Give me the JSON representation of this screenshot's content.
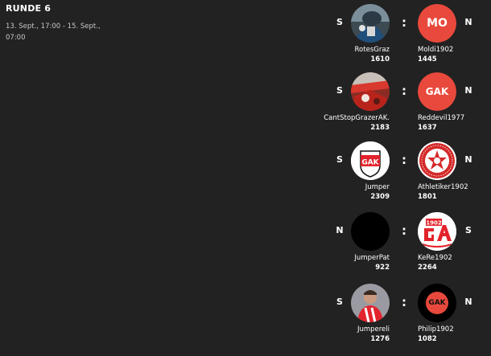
{
  "round": {
    "title": "RUNDE 6",
    "dates_line1": "13. Sept., 17:00 - 15. Sept.,",
    "dates_line2": "07:00"
  },
  "colors": {
    "background": "#222222",
    "accent_red": "#e8493c"
  },
  "matches": [
    {
      "left": {
        "name": "RotesGraz",
        "score": "1610",
        "result": "S",
        "avatar": "photo-avatar"
      },
      "right": {
        "name": "Moldi1902",
        "score": "1445",
        "result": "N",
        "avatar": "initials-avatar",
        "initials": "MO"
      }
    },
    {
      "left": {
        "name": "CantStopGrazerAK.",
        "score": "2183",
        "result": "S",
        "avatar": "photo-avatar"
      },
      "right": {
        "name": "Reddevil1977",
        "score": "1637",
        "result": "N",
        "avatar": "initials-avatar",
        "initials": "GAK"
      }
    },
    {
      "left": {
        "name": "Jumper",
        "score": "2309",
        "result": "S",
        "avatar": "gak-crest-icon",
        "crest_text": "GAK"
      },
      "right": {
        "name": "Athletiker1902",
        "score": "1801",
        "result": "N",
        "avatar": "star-crest-icon"
      }
    },
    {
      "left": {
        "name": "JumperPat",
        "score": "922",
        "result": "N",
        "avatar": "blank-avatar"
      },
      "right": {
        "name": "KeRe1902",
        "score": "2264",
        "result": "S",
        "avatar": "ga-1902-logo-icon",
        "logo_text": "1902"
      }
    },
    {
      "left": {
        "name": "Jumpereli",
        "score": "1276",
        "result": "S",
        "avatar": "photo-avatar"
      },
      "right": {
        "name": "Philip1902",
        "score": "1082",
        "result": "N",
        "avatar": "initials-avatar",
        "initials": "GAK"
      }
    }
  ],
  "separator": ":"
}
